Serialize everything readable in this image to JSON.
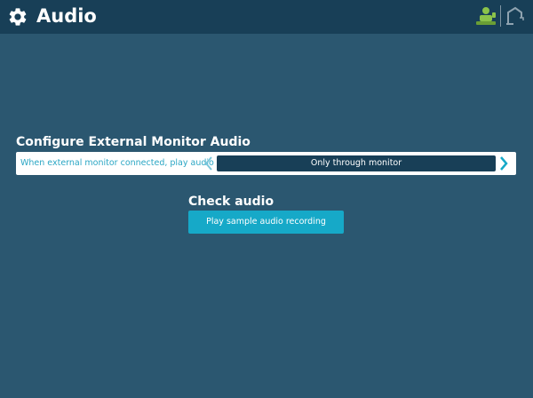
{
  "header": {
    "title": "Audio",
    "settings_icon": "gear-icon",
    "status_icons": [
      "robot-icon",
      "robot-arm-icon"
    ]
  },
  "external_monitor": {
    "heading": "Configure External Monitor Audio",
    "setting_label": "When external monitor connected, play audio",
    "selected_value": "Only through monitor",
    "prev_icon": "chevron-left-icon",
    "next_icon": "chevron-right-icon"
  },
  "check_audio": {
    "heading": "Check audio",
    "button_label": "Play sample audio recording"
  },
  "colors": {
    "background": "#2b5770",
    "header": "#183f57",
    "accent": "#16a9c8",
    "robot": "#8bc34a"
  }
}
